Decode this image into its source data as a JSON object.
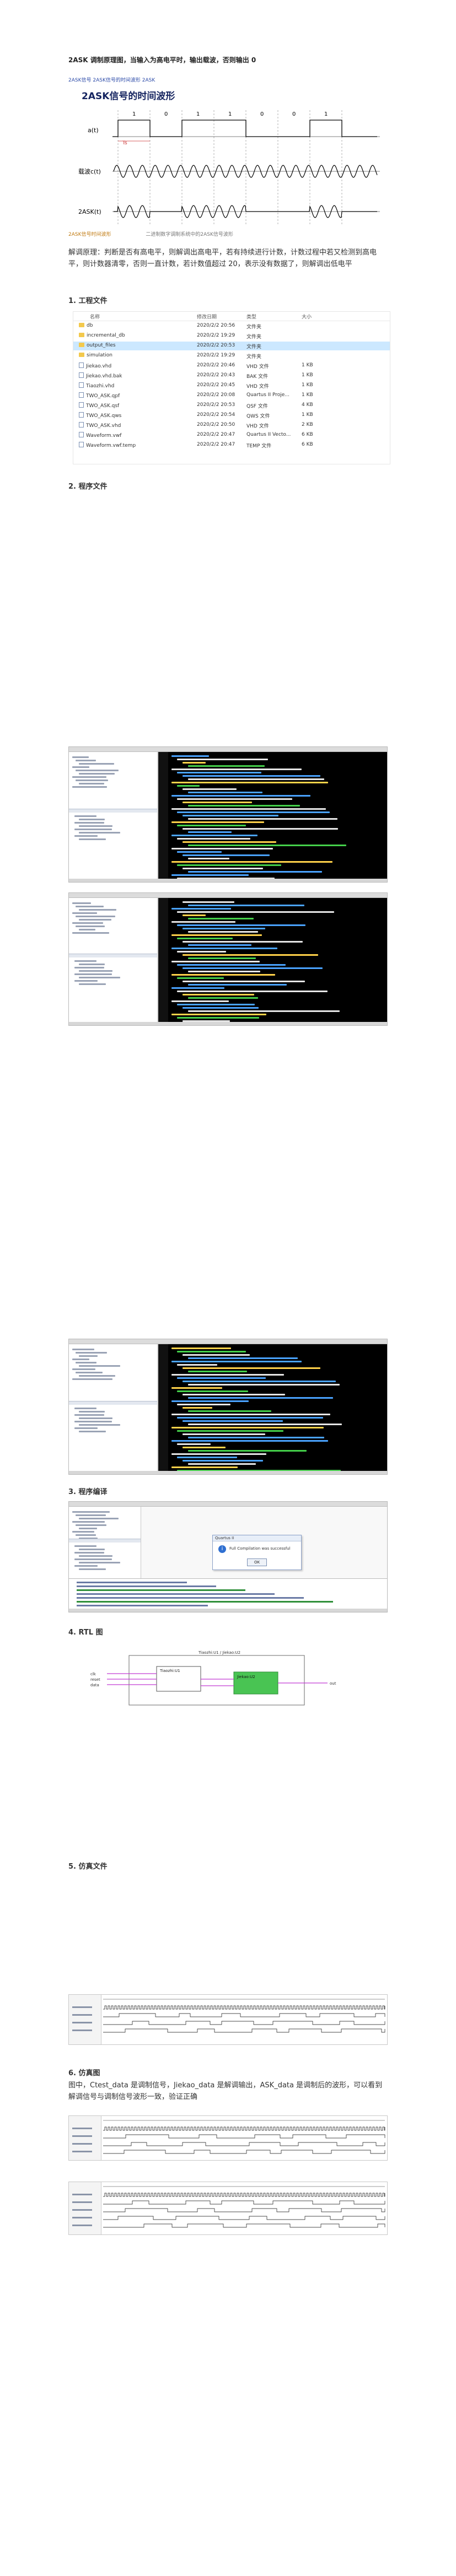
{
  "intro": "2ASK 调制原理图，当输入为高电平时，输出载波，否则输出 0",
  "figure": {
    "link_text": "2ASK信号 2ASK信号的时间波形 2ASK",
    "title": "2ASK信号的时间波形",
    "signal_labels": [
      "a(t)",
      "载波c(t)",
      "2ASK(t)"
    ],
    "bit_labels": [
      "1",
      "0",
      "1",
      "1",
      "0",
      "0",
      "1"
    ],
    "ts_label": "Ts",
    "caption_a": "2ASK信号时间波形",
    "caption_b": "二进制数字调制系统中的2ASK信号波形"
  },
  "description": "解调原理：判断是否有高电平，则解调出高电平，若有持续进行计数，计数过程中若又检测到高电平，则计数器清零，否则一直计数，若计数值超过 20，表示没有数据了，则解调出低电平",
  "sections": {
    "s1": "1. 工程文件",
    "s2": "2. 程序文件",
    "s3": "3. 程序编译",
    "s4": "4. RTL 图",
    "s5": "5. 仿真文件",
    "s6": "6. 仿真图"
  },
  "explorer": {
    "headers": [
      "名称",
      "修改日期",
      "类型",
      "大小"
    ],
    "rows": [
      {
        "name": "db",
        "date": "2020/2/2 20:56",
        "type": "文件夹",
        "size": "",
        "kind": "folder"
      },
      {
        "name": "incremental_db",
        "date": "2020/2/2 19:29",
        "type": "文件夹",
        "size": "",
        "kind": "folder"
      },
      {
        "name": "output_files",
        "date": "2020/2/2 20:53",
        "type": "文件夹",
        "size": "",
        "kind": "folder"
      },
      {
        "name": "simulation",
        "date": "2020/2/2 19:29",
        "type": "文件夹",
        "size": "",
        "kind": "folder"
      },
      {
        "name": "Jiekao.vhd",
        "date": "2020/2/2 20:46",
        "type": "VHD 文件",
        "size": "1 KB",
        "kind": "file"
      },
      {
        "name": "Jiekao.vhd.bak",
        "date": "2020/2/2 20:43",
        "type": "BAK 文件",
        "size": "1 KB",
        "kind": "file"
      },
      {
        "name": "Tiaozhi.vhd",
        "date": "2020/2/2 20:45",
        "type": "VHD 文件",
        "size": "1 KB",
        "kind": "file"
      },
      {
        "name": "TWO_ASK.qpf",
        "date": "2020/2/2 20:08",
        "type": "Quartus II Proje...",
        "size": "1 KB",
        "kind": "file"
      },
      {
        "name": "TWO_ASK.qsf",
        "date": "2020/2/2 20:53",
        "type": "QSF 文件",
        "size": "4 KB",
        "kind": "file"
      },
      {
        "name": "TWO_ASK.qws",
        "date": "2020/2/2 20:54",
        "type": "QWS 文件",
        "size": "1 KB",
        "kind": "file"
      },
      {
        "name": "TWO_ASK.vhd",
        "date": "2020/2/2 20:50",
        "type": "VHD 文件",
        "size": "2 KB",
        "kind": "file"
      },
      {
        "name": "Waveform.vwf",
        "date": "2020/2/2 20:47",
        "type": "Quartus II Vecto...",
        "size": "6 KB",
        "kind": "file"
      },
      {
        "name": "Waveform.vwf.temp",
        "date": "2020/2/2 20:47",
        "type": "TEMP 文件",
        "size": "6 KB",
        "kind": "file"
      }
    ]
  },
  "compile_dialog": {
    "title": "Quartus II",
    "message": "Full Compilation was successful",
    "ok": "OK"
  },
  "rtl": {
    "ports_in": [
      "clk",
      "reset",
      "data"
    ],
    "port_out": "out",
    "blocks": [
      "Tiaozhi:U1",
      "Jiekao:U2"
    ]
  },
  "sim_description": "图中，Ctest_data 是调制信号，Jiekao_data 是解调输出，ASK_data 是调制后的波形，可以看到解调信号与调制信号波形一致，验证正确",
  "colors": {
    "code_bg": "#000000",
    "kw": "#4aa3ff",
    "str": "#ffd24a",
    "cmt": "#44d04a",
    "plain": "#e6e6e6",
    "wave_green": "#49c453"
  }
}
